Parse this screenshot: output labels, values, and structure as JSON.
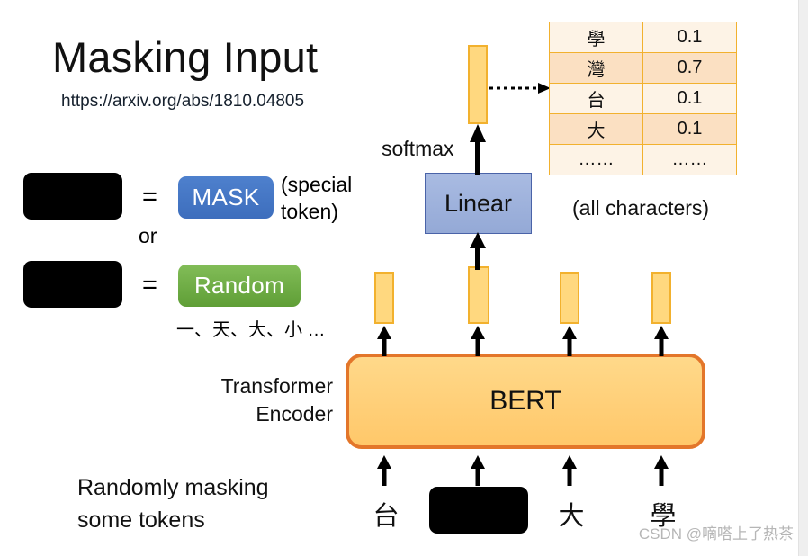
{
  "slide": {
    "title": "Masking Input",
    "paper_link": "https://arxiv.org/abs/1810.04805",
    "watermark": "CSDN @嘀嗒上了热茶"
  },
  "legend": {
    "equals_1": "=",
    "equals_2": "=",
    "or": "or",
    "mask_label": "MASK",
    "special_token_note": "(special\ntoken)",
    "random_label": "Random",
    "random_examples": "一、天、大、小 …"
  },
  "diagram": {
    "bert_label": "BERT",
    "linear_label": "Linear",
    "softmax_label": "softmax",
    "encoder_note": "Transformer\nEncoder",
    "bottom_note": "Randomly masking\nsome tokens",
    "all_characters_note": "(all characters)",
    "input_tokens": [
      "台",
      "",
      "大",
      "學"
    ],
    "masked_index": 1
  },
  "probability_table": {
    "rows": [
      {
        "char": "學",
        "prob": "0.1"
      },
      {
        "char": "灣",
        "prob": "0.7"
      },
      {
        "char": "台",
        "prob": "0.1"
      },
      {
        "char": "大",
        "prob": "0.1"
      },
      {
        "char": "……",
        "prob": "……"
      }
    ]
  },
  "colors": {
    "bert_fill": "#ffcf78",
    "bert_border": "#e3762a",
    "linear_fill": "#94a9d6",
    "linear_border": "#4a63a8",
    "vector_fill": "#ffd87f",
    "vector_border": "#f2b12e",
    "mask_pill": "#4472c4",
    "random_pill": "#70ad47",
    "table_border": "#f2b12e",
    "table_row_light": "#fdf3e6",
    "table_row_dark": "#fbe0c2"
  }
}
